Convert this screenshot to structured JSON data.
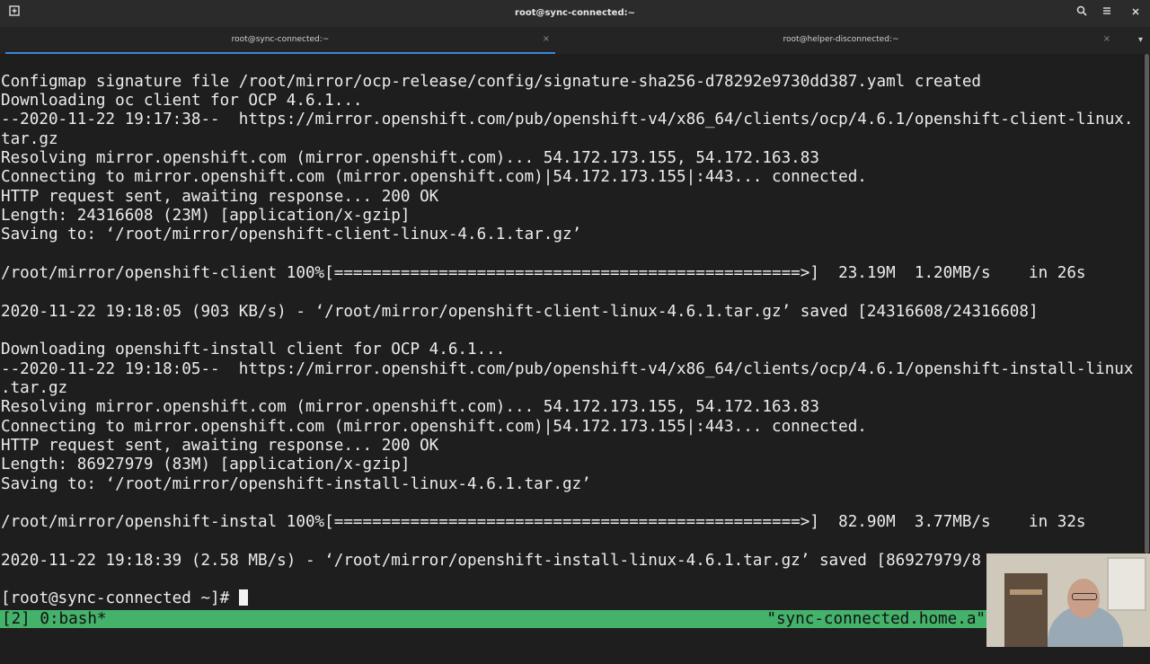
{
  "window": {
    "title": "root@sync-connected:~",
    "new_tab_icon": "new-tab-icon",
    "search_icon": "search-icon",
    "menu_icon": "hamburger-menu-icon",
    "close_icon": "close-icon"
  },
  "tabs": [
    {
      "label": "root@sync-connected:~",
      "close": "×"
    },
    {
      "label": "root@helper-disconnected:~",
      "close": "×"
    }
  ],
  "tab_dropdown": "▾",
  "terminal": {
    "lines": [
      "Configmap signature file /root/mirror/ocp-release/config/signature-sha256-d78292e9730dd387.yaml created",
      "Downloading oc client for OCP 4.6.1...",
      "--2020-11-22 19:17:38--  https://mirror.openshift.com/pub/openshift-v4/x86_64/clients/ocp/4.6.1/openshift-client-linux.",
      "tar.gz",
      "Resolving mirror.openshift.com (mirror.openshift.com)... 54.172.173.155, 54.172.163.83",
      "Connecting to mirror.openshift.com (mirror.openshift.com)|54.172.173.155|:443... connected.",
      "HTTP request sent, awaiting response... 200 OK",
      "Length: 24316608 (23M) [application/x-gzip]",
      "Saving to: ‘/root/mirror/openshift-client-linux-4.6.1.tar.gz’",
      "",
      "/root/mirror/openshift-client 100%[=================================================>]  23.19M  1.20MB/s    in 26s",
      "",
      "2020-11-22 19:18:05 (903 KB/s) - ‘/root/mirror/openshift-client-linux-4.6.1.tar.gz’ saved [24316608/24316608]",
      "",
      "Downloading openshift-install client for OCP 4.6.1...",
      "--2020-11-22 19:18:05--  https://mirror.openshift.com/pub/openshift-v4/x86_64/clients/ocp/4.6.1/openshift-install-linux",
      ".tar.gz",
      "Resolving mirror.openshift.com (mirror.openshift.com)... 54.172.173.155, 54.172.163.83",
      "Connecting to mirror.openshift.com (mirror.openshift.com)|54.172.173.155|:443... connected.",
      "HTTP request sent, awaiting response... 200 OK",
      "Length: 86927979 (83M) [application/x-gzip]",
      "Saving to: ‘/root/mirror/openshift-install-linux-4.6.1.tar.gz’",
      "",
      "/root/mirror/openshift-instal 100%[=================================================>]  82.90M  3.77MB/s    in 32s",
      "",
      "2020-11-22 19:18:39 (2.58 MB/s) - ‘/root/mirror/openshift-install-linux-4.6.1.tar.gz’ saved [86927979/8"
    ],
    "prompt": "[root@sync-connected ~]# "
  },
  "statusbar": {
    "left": "[2] 0:bash*",
    "right": "\"sync-connected.home.a\""
  },
  "colors": {
    "terminal_bg": "#1e1e1e",
    "terminal_fg": "#ececec",
    "statusbar_bg": "#44b26b",
    "tab_active_underline": "#3a85d8"
  }
}
